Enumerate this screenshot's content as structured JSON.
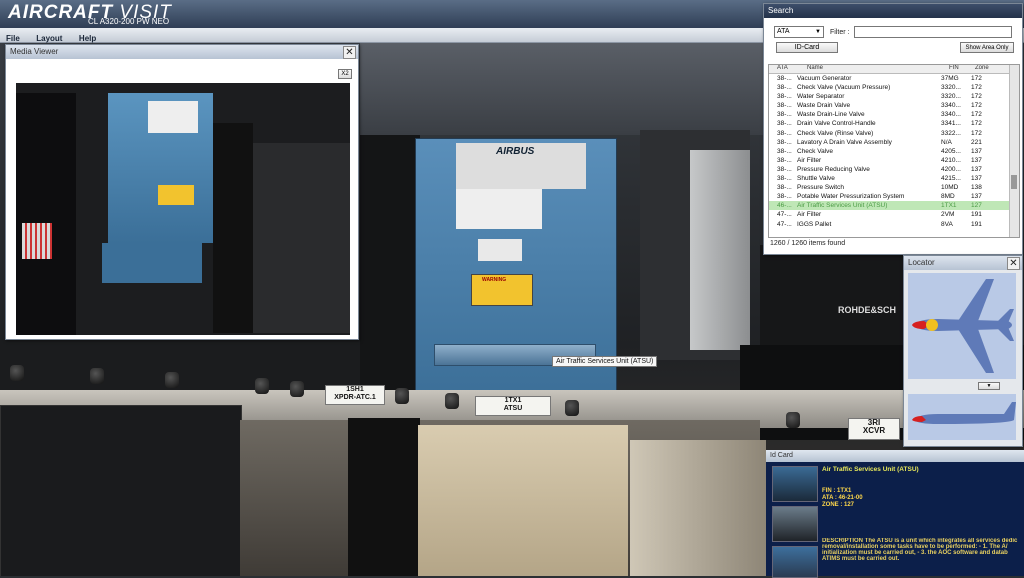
{
  "app": {
    "brand_a": "AIRCRAFT",
    "brand_b": "VISIT",
    "subtitle": "CL A320-200 PW NEO"
  },
  "menu": [
    "File",
    "Layout",
    "Help"
  ],
  "media_viewer": {
    "title": "Media Viewer",
    "close": "✕",
    "zoom_button": "X2"
  },
  "scene_labels": {
    "atsu_brand": "AIRBUS",
    "warning": "WARNING",
    "tag_1tx1": "1TX1",
    "tag_atsu": "ATSU",
    "tag_1sh1": "1SH1",
    "tag_xpdr": "XPDR-ATC.1",
    "tag_3ri": "3RI",
    "tag_xcvr": "XCVR",
    "rohde": "ROHDE&SCH",
    "tooltip": "Air Traffic Services Unit (ATSU)"
  },
  "search": {
    "title": "Search",
    "ata_select": "ATA",
    "filter_label": "Filter :",
    "filter_value": "",
    "id_card_button": "ID-Card",
    "show_area_button": "Show Area Only",
    "columns": [
      "ATA",
      "Name",
      "FIN",
      "Zone"
    ],
    "rows": [
      [
        "38-...",
        "Vacuum Generator",
        "37MG",
        "172"
      ],
      [
        "38-...",
        "Check Valve (Vacuum Pressure)",
        "3320...",
        "172"
      ],
      [
        "38-...",
        "Water Separator",
        "3320...",
        "172"
      ],
      [
        "38-...",
        "Waste Drain Valve",
        "3340...",
        "172"
      ],
      [
        "38-...",
        "Waste Drain-Line Valve",
        "3340...",
        "172"
      ],
      [
        "38-...",
        "Drain Valve Control-Handle",
        "3341...",
        "172"
      ],
      [
        "38-...",
        "Check Valve (Rinse Valve)",
        "3322...",
        "172"
      ],
      [
        "38-...",
        "Lavatory A Drain Valve Assembly",
        "N/A",
        "221"
      ],
      [
        "38-...",
        "Check Valve",
        "4205...",
        "137"
      ],
      [
        "38-...",
        "Air Filter",
        "4210...",
        "137"
      ],
      [
        "38-...",
        "Pressure Reducing Valve",
        "4200...",
        "137"
      ],
      [
        "38-...",
        "Shuttle Valve",
        "4215...",
        "137"
      ],
      [
        "38-...",
        "Pressure Switch",
        "10MD",
        "138"
      ],
      [
        "38-...",
        "Potable Water Pressurization System",
        "8MD",
        "137"
      ],
      [
        "46-...",
        "Air Traffic Services Unit (ATSU)",
        "1TX1",
        "127"
      ],
      [
        "47-...",
        "Air Filter",
        "2VM",
        "191"
      ],
      [
        "47-...",
        "IGGS Pallet",
        "8VA",
        "191"
      ]
    ],
    "selected_index": 14,
    "count_text": "1260 / 1260 items found"
  },
  "locator": {
    "title": "Locator",
    "close": "✕",
    "chevron": "▼"
  },
  "id_card": {
    "title": "Id Card",
    "name": "Air Traffic Services Unit (ATSU)",
    "fin": "FIN : 1TX1",
    "ata": "ATA : 46-21-00",
    "zone": "ZONE : 127",
    "desc1": "DESCRIPTION The ATSU is a unit which integrates all services dedic",
    "desc2": "removal/installation some tasks have to be performed: - 1. The A/",
    "desc3": "initialization must be carried out, - 3. the AOC software and datab",
    "desc4": "ATIMS must be carried out."
  },
  "colors": {
    "accent": "#2f3e55",
    "selection": "#bfe7b6",
    "idcard_bg": "#0c1f4a",
    "atsu_blue": "#4d86b4"
  }
}
